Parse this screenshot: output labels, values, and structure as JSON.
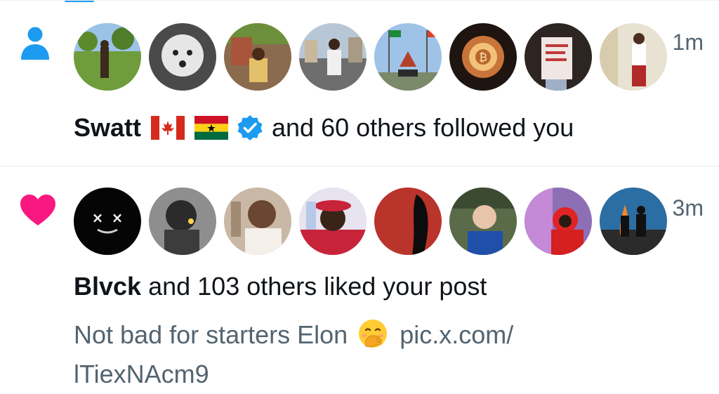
{
  "notifications": [
    {
      "type": "follow",
      "type_icon": "person-icon",
      "icon_color": "#1d9bf0",
      "timestamp": "1m",
      "actor": "Swatt",
      "actor_badges": [
        "canada-flag-emoji",
        "ghana-flag-emoji",
        "verified-badge-icon"
      ],
      "summary_rest": "and 60 others followed you",
      "avatar_count": 8
    },
    {
      "type": "like",
      "type_icon": "heart-icon",
      "icon_color": "#f91880",
      "timestamp": "3m",
      "actor": "Blvck",
      "summary_rest": "and 103 others liked your post",
      "post_text": "Not bad for starters Elon",
      "post_emoji": "face-with-hand-over-mouth-emoji",
      "post_link": "pic.x.com/\nlTiexNAcm9",
      "avatar_count": 8
    }
  ],
  "colors": {
    "accent": "#1d9bf0",
    "like": "#f91880",
    "secondary_text": "#536471",
    "primary_text": "#0f1419"
  }
}
